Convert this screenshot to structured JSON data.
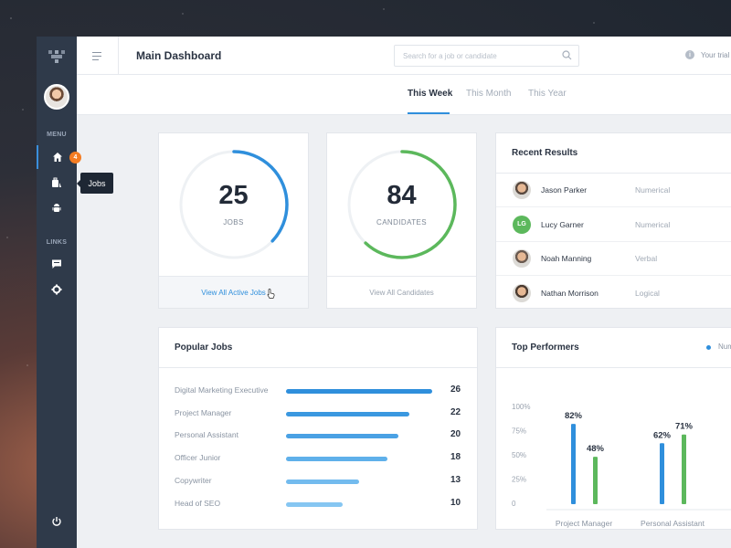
{
  "header": {
    "title": "Main Dashboard",
    "search_placeholder": "Search for a job or candidate",
    "trial_text": "Your trial"
  },
  "sidebar": {
    "menu_label": "MENU",
    "links_label": "LINKS",
    "badge_count": "4",
    "tooltip": "Jobs",
    "items": [
      {
        "icon": "home-icon",
        "active": true
      },
      {
        "icon": "briefcase-icon",
        "active": false
      },
      {
        "icon": "android-icon",
        "active": false
      },
      {
        "icon": "chat-icon",
        "active": false
      },
      {
        "icon": "gear-icon",
        "active": false
      },
      {
        "icon": "power-icon",
        "active": false
      }
    ]
  },
  "tabs": [
    {
      "label": "This Week",
      "active": true
    },
    {
      "label": "This Month",
      "active": false
    },
    {
      "label": "This Year",
      "active": false
    }
  ],
  "stats": [
    {
      "value": "25",
      "label": "JOBS",
      "link": "View All Active Jobs",
      "progress": 0.37,
      "color": "#2f8fdc"
    },
    {
      "value": "84",
      "label": "CANDIDATES",
      "link": "View All Candidates",
      "progress": 0.62,
      "color": "#5cb85c"
    }
  ],
  "recent_results": {
    "title": "Recent Results",
    "rows": [
      {
        "name": "Jason Parker",
        "category": "Numerical",
        "initials": "",
        "avatar_color": "#5a4a40"
      },
      {
        "name": "Lucy Garner",
        "category": "Numerical",
        "initials": "LG",
        "avatar_color": "#5cb85c"
      },
      {
        "name": "Noah Manning",
        "category": "Verbal",
        "initials": "",
        "avatar_color": "#6a5a50"
      },
      {
        "name": "Nathan Morrison",
        "category": "Logical",
        "initials": "",
        "avatar_color": "#4a3a30"
      }
    ]
  },
  "popular_jobs": {
    "title": "Popular Jobs",
    "max": 26,
    "items": [
      {
        "name": "Digital Marketing Executive",
        "count": 26,
        "color": "#2f8fdc"
      },
      {
        "name": "Project Manager",
        "count": 22,
        "color": "#3a98e0"
      },
      {
        "name": "Personal Assistant",
        "count": 20,
        "color": "#4aa1e4"
      },
      {
        "name": "Officer Junior",
        "count": 18,
        "color": "#5fb0ea"
      },
      {
        "name": "Copywriter",
        "count": 13,
        "color": "#73bbee"
      },
      {
        "name": "Head of SEO",
        "count": 10,
        "color": "#86c6f2"
      }
    ]
  },
  "top_performers": {
    "title": "Top Performers",
    "legend": "Num"
  },
  "chart_data": {
    "type": "bar",
    "title": "Top Performers",
    "categories": [
      "Project Manager",
      "Personal Assistant"
    ],
    "y_ticks": [
      "100%",
      "75%",
      "50%",
      "25%",
      "0"
    ],
    "ylim": [
      0,
      100
    ],
    "series": [
      {
        "name": "Num",
        "color": "#2f8fdc",
        "values": [
          82,
          62
        ]
      },
      {
        "color": "#5cb85c",
        "values": [
          48,
          71
        ]
      }
    ],
    "value_labels": [
      [
        "82%",
        "62%"
      ],
      [
        "48%",
        "71%"
      ]
    ],
    "grid": false,
    "legend_position": "top-right"
  }
}
